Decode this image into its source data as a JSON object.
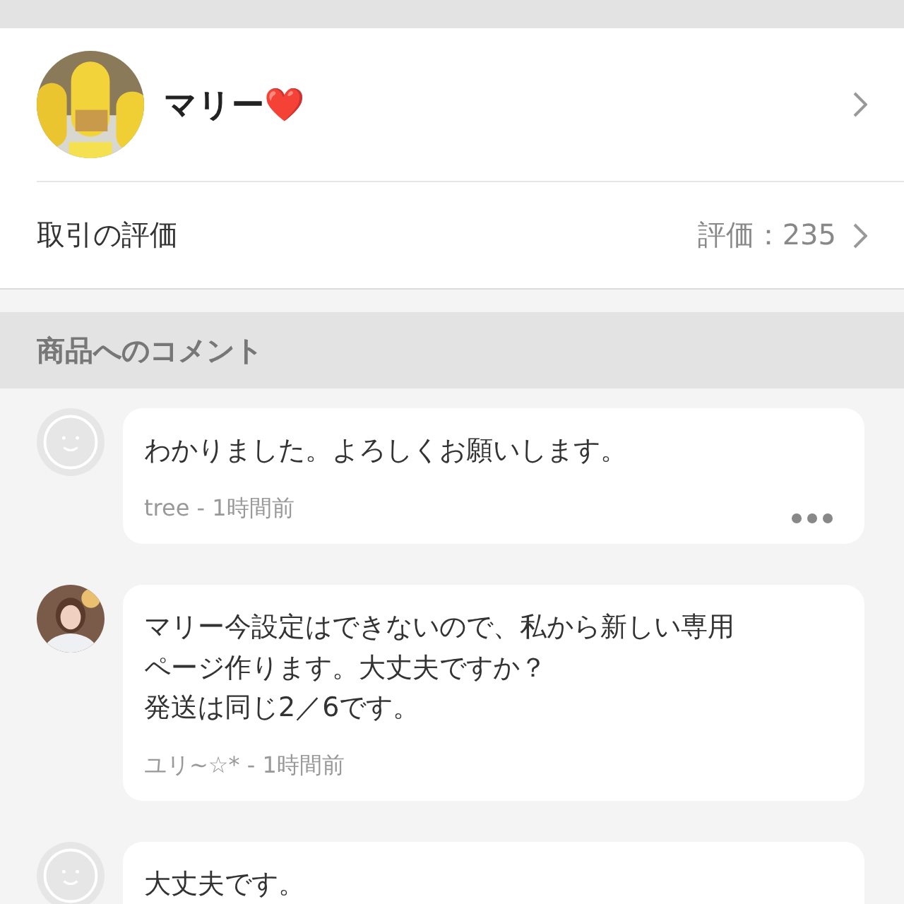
{
  "seller": {
    "name": "マリー❤️"
  },
  "rating": {
    "label": "取引の評価",
    "value": "評価：235"
  },
  "comments_section": {
    "title": "商品へのコメント"
  },
  "comments": [
    {
      "avatar": {
        "kind": "default"
      },
      "lines": [
        "わかりました。よろしくお願いします。"
      ],
      "meta": "tree - 1時間前",
      "more_menu": true
    },
    {
      "lines": [
        "マリー今設定はできないので、私から新しい専用",
        "ページ作ります。大丈夫ですか？",
        "発送は同じ2／6です。"
      ],
      "meta": "ユリ~☆* - 1時間前",
      "more_menu": false
    },
    {
      "avatar": {
        "kind": "default"
      },
      "lines": [
        "大丈夫です。"
      ]
    }
  ]
}
